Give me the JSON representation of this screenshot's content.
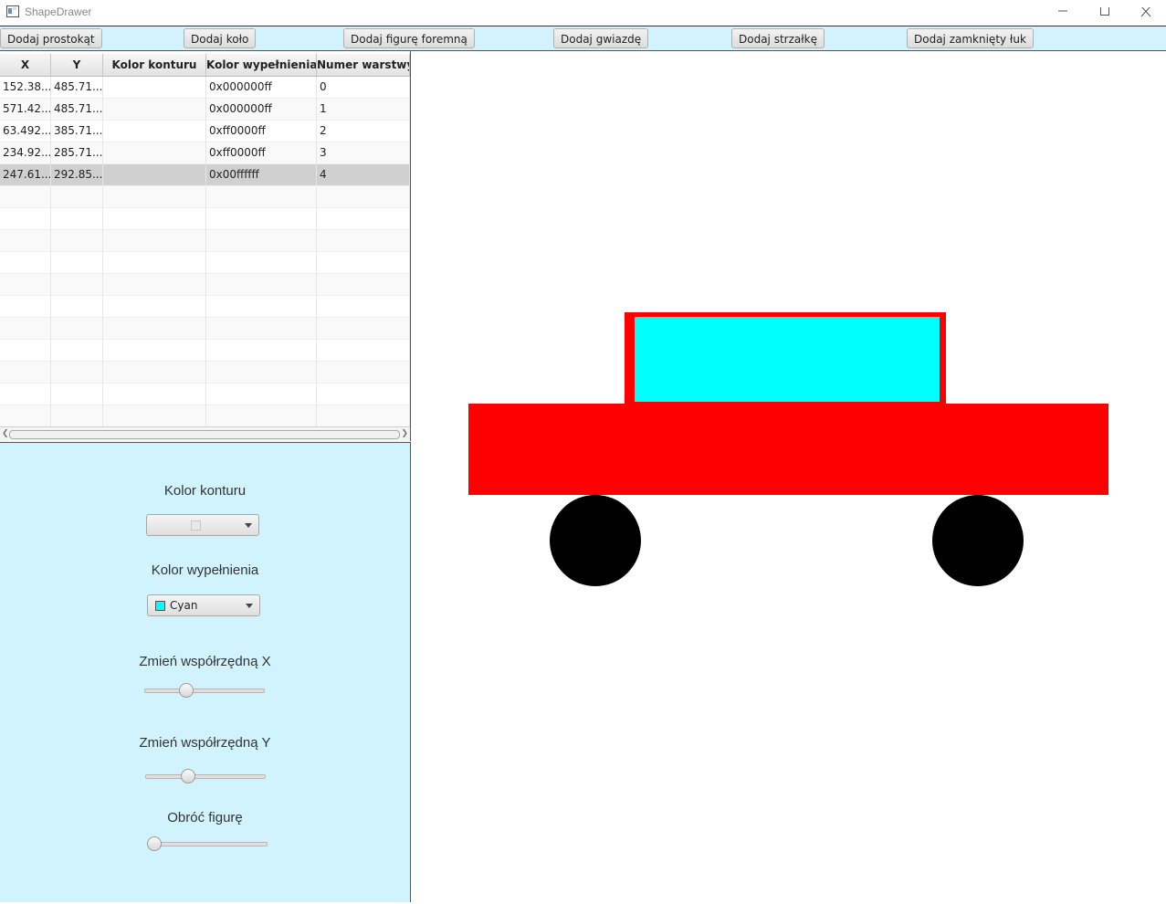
{
  "window": {
    "title": "ShapeDrawer"
  },
  "toolbar": {
    "buttons": [
      {
        "label": "Dodaj prostokąt"
      },
      {
        "label": "Dodaj koło"
      },
      {
        "label": "Dodaj figurę foremną"
      },
      {
        "label": "Dodaj gwiazdę"
      },
      {
        "label": "Dodaj strzałkę"
      },
      {
        "label": "Dodaj zamknięty łuk"
      }
    ]
  },
  "table": {
    "columns": [
      "X",
      "Y",
      "Kolor konturu",
      "Kolor wypełnienia",
      "Numer warstwy"
    ],
    "rows": [
      [
        "152.38...",
        "485.71...",
        "",
        "0x000000ff",
        "0"
      ],
      [
        "571.42...",
        "485.71...",
        "",
        "0x000000ff",
        "1"
      ],
      [
        "63.492...",
        "385.71...",
        "",
        "0xff0000ff",
        "2"
      ],
      [
        "234.92...",
        "285.71...",
        "",
        "0xff0000ff",
        "3"
      ],
      [
        "247.61...",
        "292.85...",
        "",
        "0x00ffffff",
        "4"
      ]
    ],
    "selected_row": 4
  },
  "controls": {
    "stroke_label": "Kolor konturu",
    "stroke_value": "",
    "fill_label": "Kolor wypełnienia",
    "fill_value": "Cyan",
    "fill_swatch": "#00ffff",
    "x_label": "Zmień współrzędną X",
    "x_slider_fraction": 0.32,
    "y_label": "Zmień współrzędną Y",
    "y_slider_fraction": 0.33,
    "rotate_label": "Obróć figurę",
    "rotate_slider_fraction": 0.0
  },
  "colors": {
    "toolbar_bg": "#d2f2fd",
    "panel_bg": "#d1f3fd",
    "car_body": "#ff0000",
    "car_window": "#00ffff",
    "wheel": "#000000"
  }
}
